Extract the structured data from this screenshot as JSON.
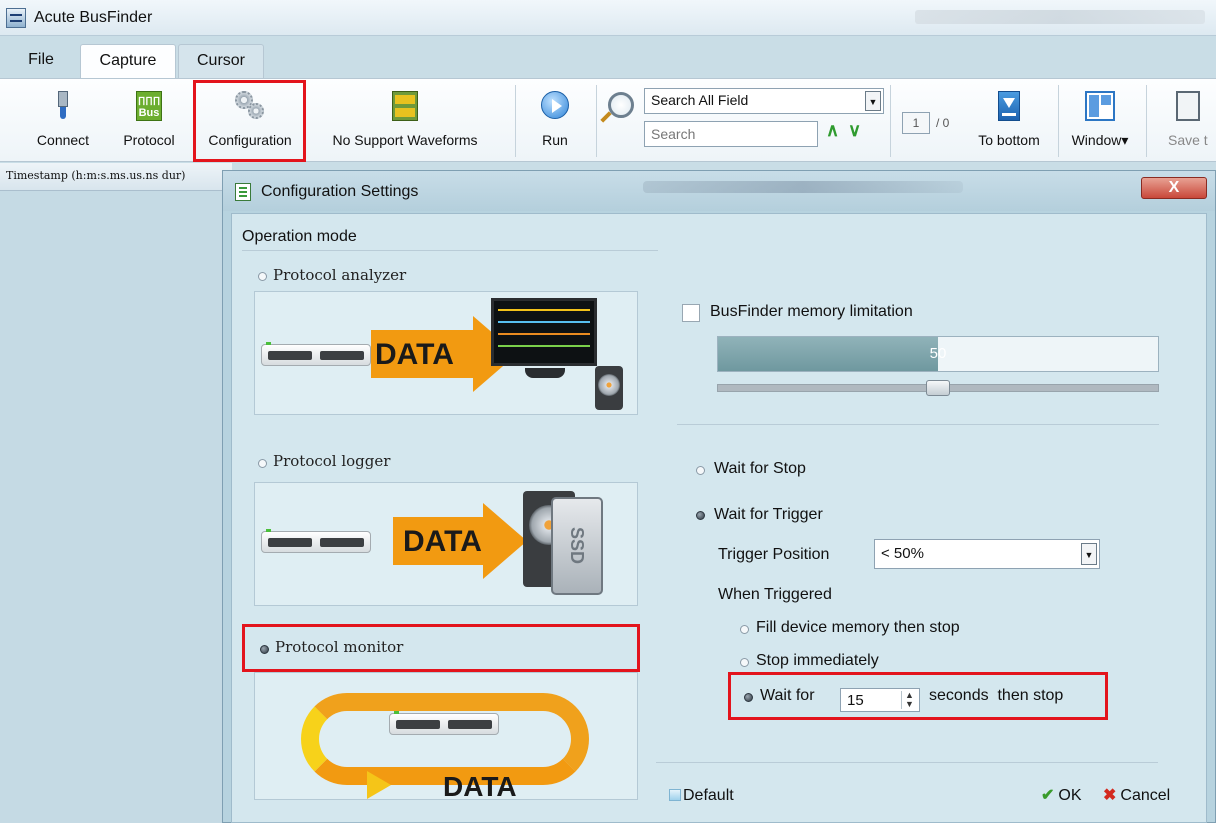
{
  "window": {
    "title": "Acute BusFinder"
  },
  "menu_tabs": [
    "File",
    "Capture",
    "Cursor"
  ],
  "ribbon": {
    "connect": "Connect",
    "protocol": "Protocol",
    "protocol_icon_text": "Bus",
    "configuration": "Configuration",
    "waveforms": "No Support Waveforms",
    "run": "Run",
    "search_field_select": "Search All Field",
    "search_placeholder": "Search",
    "page_current": "1",
    "page_total": "/ 0",
    "to_bottom": "To bottom",
    "window": "Window",
    "save": "Save t"
  },
  "left_pane": {
    "column_header": "Timestamp (h:m:s.ms.us.ns dur)"
  },
  "dialog": {
    "title": "Configuration Settings",
    "close_label": "X",
    "operation_mode_label": "Operation mode",
    "modes": [
      {
        "label": "Protocol analyzer",
        "selected": false
      },
      {
        "label": "Protocol logger",
        "selected": false
      },
      {
        "label": "Protocol monitor",
        "selected": true
      }
    ],
    "data_text": "DATA",
    "ssd_text": "SSD",
    "memory_limitation_label": "BusFinder memory limitation",
    "memory_limitation_checked": false,
    "memory_value": "50",
    "memory_fraction": 0.5,
    "wait_for_stop_label": "Wait for Stop",
    "wait_for_trigger_label": "Wait for Trigger",
    "wait_for_trigger_selected": true,
    "trigger_position_label": "Trigger Position",
    "trigger_position_value": "< 50%",
    "when_triggered_label": "When Triggered",
    "fill_memory_label": "Fill device memory then stop",
    "stop_immediately_label": "Stop immediately",
    "wait_for_label": "Wait for",
    "wait_seconds_value": "15",
    "seconds_then_stop_label": "seconds  then stop",
    "default_label": "Default",
    "ok_label": "OK",
    "cancel_label": "Cancel"
  },
  "colors": {
    "highlight": "#e3141c",
    "data_arrow": "#f29a11",
    "dialog_bg": "#d4e7ee"
  }
}
